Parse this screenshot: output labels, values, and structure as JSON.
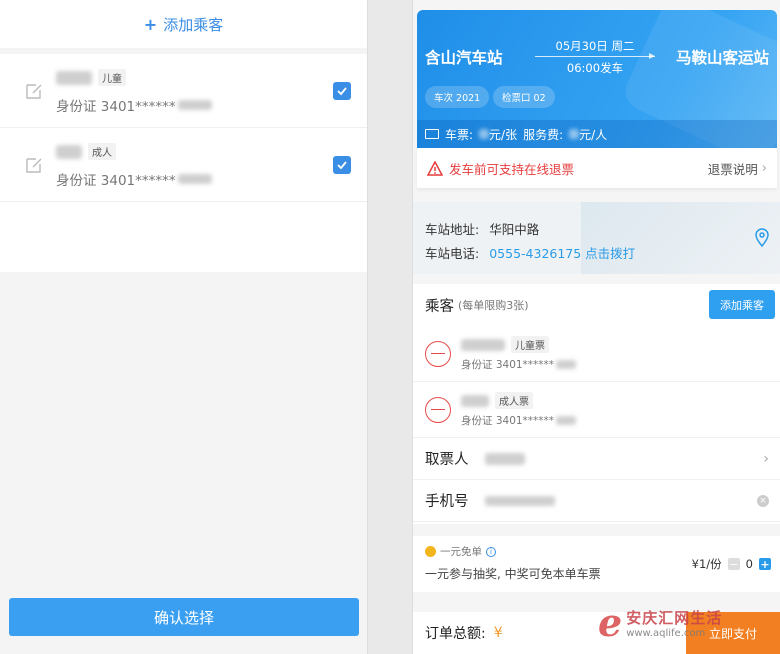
{
  "left": {
    "add_passenger": "添加乘客",
    "passengers": [
      {
        "tag": "儿童",
        "id_prefix": "身份证 3401******"
      },
      {
        "tag": "成人",
        "id_prefix": "身份证 3401******"
      }
    ],
    "confirm_label": "确认选择"
  },
  "right": {
    "from_station": "含山汽车站",
    "to_station": "马鞍山客运站",
    "date": "05月30日 周二",
    "time": "06:00发车",
    "bus_no": "车次 2021",
    "gate": "检票口 02",
    "fare_label": "车票:",
    "fare_unit": "元/张",
    "service_label": "服务费:",
    "service_unit": "元/人",
    "refund_warning": "发车前可支持在线退票",
    "refund_link": "退票说明",
    "address_label": "车站地址:",
    "address_value": "华阳中路",
    "phone_label": "车站电话:",
    "phone_value": "0555-4326175 点击拨打",
    "passengers_title": "乘客",
    "passengers_limit": "(每单限购3张)",
    "add_passenger_btn": "添加乘客",
    "passengers": [
      {
        "tag": "儿童票",
        "id_prefix": "身份证 3401******"
      },
      {
        "tag": "成人票",
        "id_prefix": "身份证 3401******"
      }
    ],
    "ticket_taker_label": "取票人",
    "phone_field_label": "手机号",
    "free_title": "一元免单",
    "free_desc": "一元参与抽奖, 中奖可免本单车票",
    "free_price": "¥1/份",
    "free_qty": "0",
    "total_label": "订单总额:",
    "total_currency": "¥",
    "pay_label": "立即支付"
  },
  "watermark": {
    "brand": "安庆汇网生活",
    "url": "www.aqlife.com"
  },
  "colors": {
    "accent": "#2f9ff0",
    "warning": "#e63c3c",
    "pay": "#f28022"
  }
}
